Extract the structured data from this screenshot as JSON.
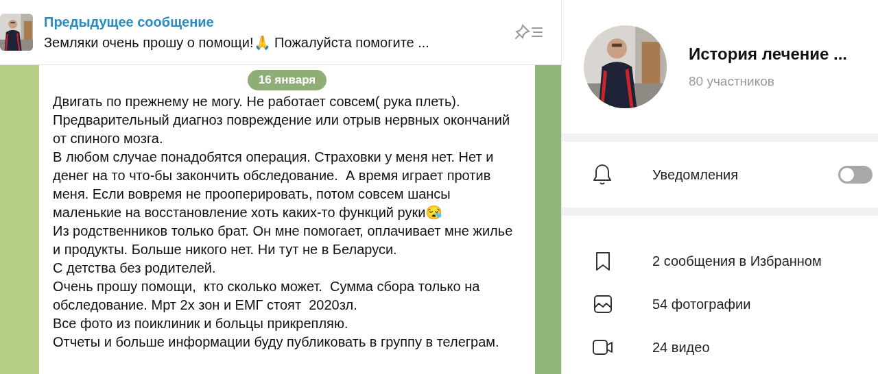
{
  "pinned": {
    "title": "Предыдущее сообщение",
    "text": "Земляки очень прошу о помощи!🙏 Пожалуйста помогите ..."
  },
  "date_badge": "16 января",
  "message": {
    "paragraphs": [
      "Двигать по прежнему не могу. Не работает совсем( рука плеть).",
      "Предварительный диагноз повреждение или отрыв нервных окончаний от спиного мозга.",
      "В любом случае понадобятся операция. Страховки у меня нет. Нет и денег на то что-бы закончить обследование.  А время играет против меня. Если вовремя не прооперировать, потом совсем шансы маленькие на восстановление хоть каких-то функций руки😪",
      "Из родственников только брат. Он мне помогает, оплачивает мне жилье и продукты. Больше никого нет. Ни тут не в Беларуси.",
      "С детства без родителей.",
      "Очень прошу помощи,  кто сколько может.  Сумма сбора только на обследование. Мрт 2х зон и ЕМГ стоят  2020зл.",
      "Все фото из поиклиник и больцы прикрепляю.",
      "Отчеты и больше информации буду публиковать в группу в телеграм."
    ]
  },
  "profile": {
    "name": "История лечение ...",
    "members": "80 участников"
  },
  "notifications": {
    "label": "Уведомления",
    "on": false
  },
  "media": [
    {
      "kind": "saved",
      "label": "2 сообщения в Избранном"
    },
    {
      "kind": "photos",
      "label": "54 фотографии"
    },
    {
      "kind": "videos",
      "label": "24 видео"
    }
  ]
}
